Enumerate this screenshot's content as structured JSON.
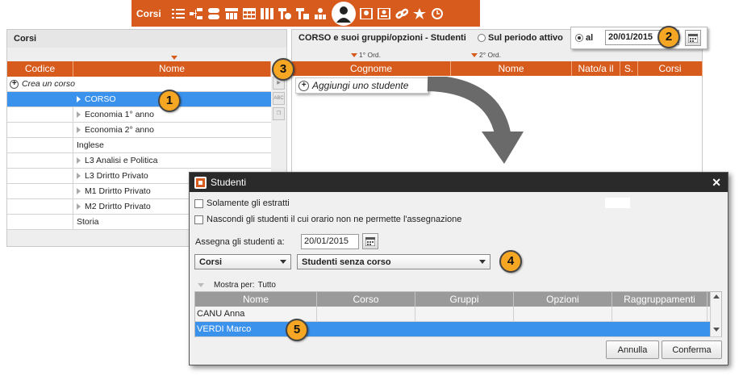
{
  "toolbar": {
    "title": "Corsi",
    "icons": [
      "list-icon",
      "tree-icon",
      "stack-icon",
      "group-tree-icon",
      "grid-icon",
      "columns-icon",
      "clock-tree-icon",
      "tree-x-icon",
      "people-tree-icon",
      "student-icon",
      "portrait-icon",
      "portrait-list-icon",
      "link-icon",
      "star-icon",
      "clock-person-icon"
    ]
  },
  "left": {
    "title": "Corsi",
    "col_codice": "Codice",
    "col_nome": "Nome",
    "create_label": "Crea un corso",
    "items": [
      {
        "name": "CORSO",
        "arrow": true,
        "selected": true
      },
      {
        "name": "Economia 1° anno",
        "arrow": true
      },
      {
        "name": "Economia 2° anno",
        "arrow": true
      },
      {
        "name": "Inglese",
        "arrow": false
      },
      {
        "name": "L3 Analisi e Politica",
        "arrow": true
      },
      {
        "name": "L3 Drirtto Privato",
        "arrow": true
      },
      {
        "name": "M1 Drirtto Privato",
        "arrow": true
      },
      {
        "name": "M2 Drirtto Privato",
        "arrow": true
      },
      {
        "name": "Storia",
        "arrow": false
      }
    ]
  },
  "right": {
    "title": "CORSO e suoi gruppi/opzioni - Studenti",
    "period_label": "Sul periodo attivo",
    "al_label": "al",
    "date": "20/01/2015",
    "sort1": "1° Ord.",
    "sort2": "2° Ord.",
    "cols": [
      "Cognome",
      "Nome",
      "Nato/a il",
      "S.",
      "Corsi"
    ],
    "add_label": "Aggiungi uno studente"
  },
  "badges": [
    "1",
    "2",
    "3",
    "4",
    "5"
  ],
  "dialog": {
    "title": "Studenti",
    "chk1": "Solamente gli estratti",
    "chk2": "Nascondi gli studenti il cui orario non ne permette l'assegnazione",
    "assign_label": "Assegna gli studenti a:",
    "assign_date": "20/01/2015",
    "select1": "Corsi",
    "select2": "Studenti senza corso",
    "show_by_label": "Mostra per:",
    "show_by_value": "Tutto",
    "cols": [
      "Nome",
      "Corso",
      "Gruppi",
      "Opzioni",
      "Raggruppamenti"
    ],
    "rows": [
      {
        "name": "CANU Anna",
        "selected": false
      },
      {
        "name": "VERDI Marco",
        "selected": true
      }
    ],
    "cancel": "Annulla",
    "confirm": "Conferma"
  },
  "colors": {
    "accent": "#d75b1c",
    "selection": "#3b92ec",
    "badge": "#f5a623"
  }
}
